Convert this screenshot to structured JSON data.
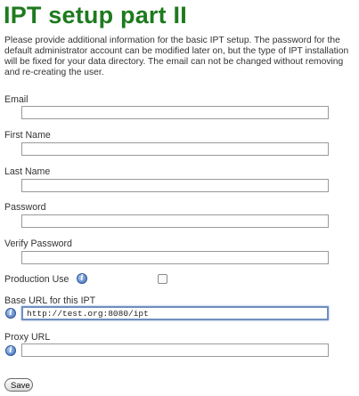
{
  "page": {
    "title": "IPT setup part II",
    "intro": "Please provide additional information for the basic IPT setup. The password for the default administrator account can be modified later on, but the type of IPT installation will be fixed for your data directory. The email can not be changed without removing and re-creating the user."
  },
  "form": {
    "email_label": "Email",
    "email_value": "",
    "first_name_label": "First Name",
    "first_name_value": "",
    "last_name_label": "Last Name",
    "last_name_value": "",
    "password_label": "Password",
    "password_value": "",
    "verify_password_label": "Verify Password",
    "verify_password_value": "",
    "production_use_label": "Production Use",
    "production_use_checked": false,
    "base_url_label": "Base URL for this IPT",
    "base_url_value": "http://test.org:8080/ipt",
    "proxy_url_label": "Proxy URL",
    "proxy_url_value": "",
    "save_label": "Save"
  },
  "icons": {
    "info": "info-icon",
    "info_glyph": "i"
  },
  "colors": {
    "title": "#1e7a1e",
    "focus_border": "#6f8fbf",
    "info_icon": "#3f6fb8"
  }
}
